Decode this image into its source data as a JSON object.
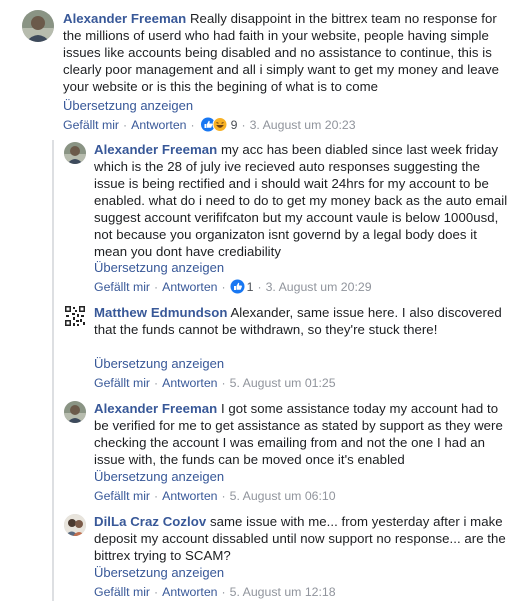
{
  "comments": [
    {
      "author": "Alexander Freeman",
      "text": "Really disappoint in the bittrex team no response for the millions of userd who had faith in your website, people having simple issues like accounts being disabled and no assistance to continue, this is clearly poor management and all i simply want to get my money and leave your website or is this the begining of what is to come",
      "translate": "Übersetzung anzeigen",
      "like": "Gefällt mir",
      "reply": "Antworten",
      "reaction_count": "9",
      "time": "3. August um 20:23"
    },
    {
      "author": "Alexander Freeman",
      "text": "my acc has been diabled since last week friday which is the 28 of july ive recieved auto responses suggesting the issue is being rectified and i should wait 24hrs for my account to be enabled. what do i need to do to get my money back as the auto email suggest account verififcaton but my account vaule is below 1000usd, not because you organizaton isnt governd by a legal body does it mean you dont have crediability",
      "translate": "Übersetzung anzeigen",
      "like": "Gefällt mir",
      "reply": "Antworten",
      "reaction_count": "1",
      "time": "3. August um 20:29"
    },
    {
      "author": "Matthew Edmundson",
      "text": "Alexander, same issue here. I also discovered that the funds cannot be withdrawn, so they're stuck there!",
      "translate": "Übersetzung anzeigen",
      "like": "Gefällt mir",
      "reply": "Antworten",
      "time": "5. August um 01:25"
    },
    {
      "author": "Alexander Freeman",
      "text": "I got some assistance today my account had to be verified for me to get assistance as stated by support as they were checking the account I was emailing from and not the one I had an issue with, the funds can be moved once it's enabled",
      "translate": "Übersetzung anzeigen",
      "like": "Gefällt mir",
      "reply": "Antworten",
      "time": "5. August um 06:10"
    },
    {
      "author": "DilLa Craz Cozlov",
      "text": "same issue with me... from yesterday after i make deposit my account dissabled until now support no response... are the bittrex trying to SCAM?",
      "translate": "Übersetzung anzeigen",
      "like": "Gefällt mir",
      "reply": "Antworten",
      "time": "5. August um 12:18"
    }
  ],
  "colors": {
    "link": "#385898",
    "meta": "#90949c",
    "like_blue": "#1877f2",
    "haha_yellow": "#f7b125"
  },
  "icons": {
    "like": "thumbs-up-icon",
    "haha": "haha-emoji-icon"
  }
}
